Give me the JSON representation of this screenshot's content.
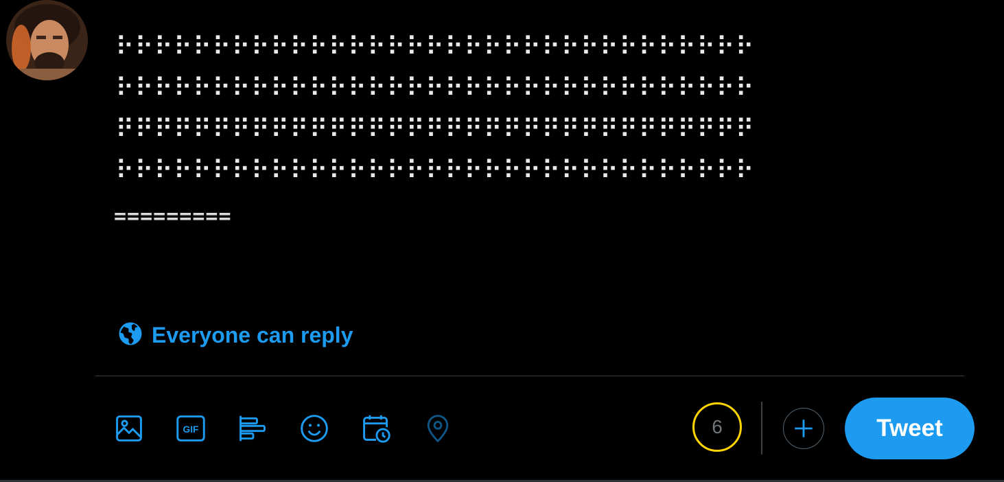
{
  "tweet": {
    "text_lines": [
      "⠗⠗⠗⠗⠗⠗⠗⠗⠗⠗⠗⠗⠗⠗⠗⠗⠗⠗⠗⠗⠗⠗⠗⠗⠗⠗⠗⠗⠗⠗⠗⠗⠗",
      "⠗⠗⠗⠗⠗⠗⠗⠗⠗⠗⠗⠗⠗⠗⠗⠗⠗⠗⠗⠗⠗⠗⠗⠗⠗⠗⠗⠗⠗⠗⠗⠗⠗",
      "⠟⠟⠟⠟⠟⠟⠟⠟⠟⠟⠟⠟⠟⠟⠟⠟⠟⠟⠟⠟⠟⠟⠟⠟⠟⠟⠟⠟⠟⠟⠟⠟⠟",
      "⠗⠗⠗⠗⠗⠗⠗⠗⠗⠗⠗⠗⠗⠗⠗⠗⠗⠗⠗⠗⠗⠗⠗⠗⠗⠗⠗⠗⠗⠗⠗⠗⠗"
    ],
    "equals_line": "========="
  },
  "reply_setting": {
    "label": "Everyone can reply",
    "icon": "globe-icon"
  },
  "toolbar": {
    "tools": [
      {
        "name": "media-icon"
      },
      {
        "name": "gif-icon",
        "label": "GIF"
      },
      {
        "name": "poll-icon"
      },
      {
        "name": "emoji-icon"
      },
      {
        "name": "schedule-icon"
      },
      {
        "name": "location-icon"
      }
    ]
  },
  "counter": {
    "remaining": "6",
    "color": "#ffd400"
  },
  "actions": {
    "add_icon": "plus-icon",
    "tweet_label": "Tweet"
  },
  "colors": {
    "accent": "#1d9bf0",
    "background": "#000000",
    "text": "#e7e9ea"
  }
}
